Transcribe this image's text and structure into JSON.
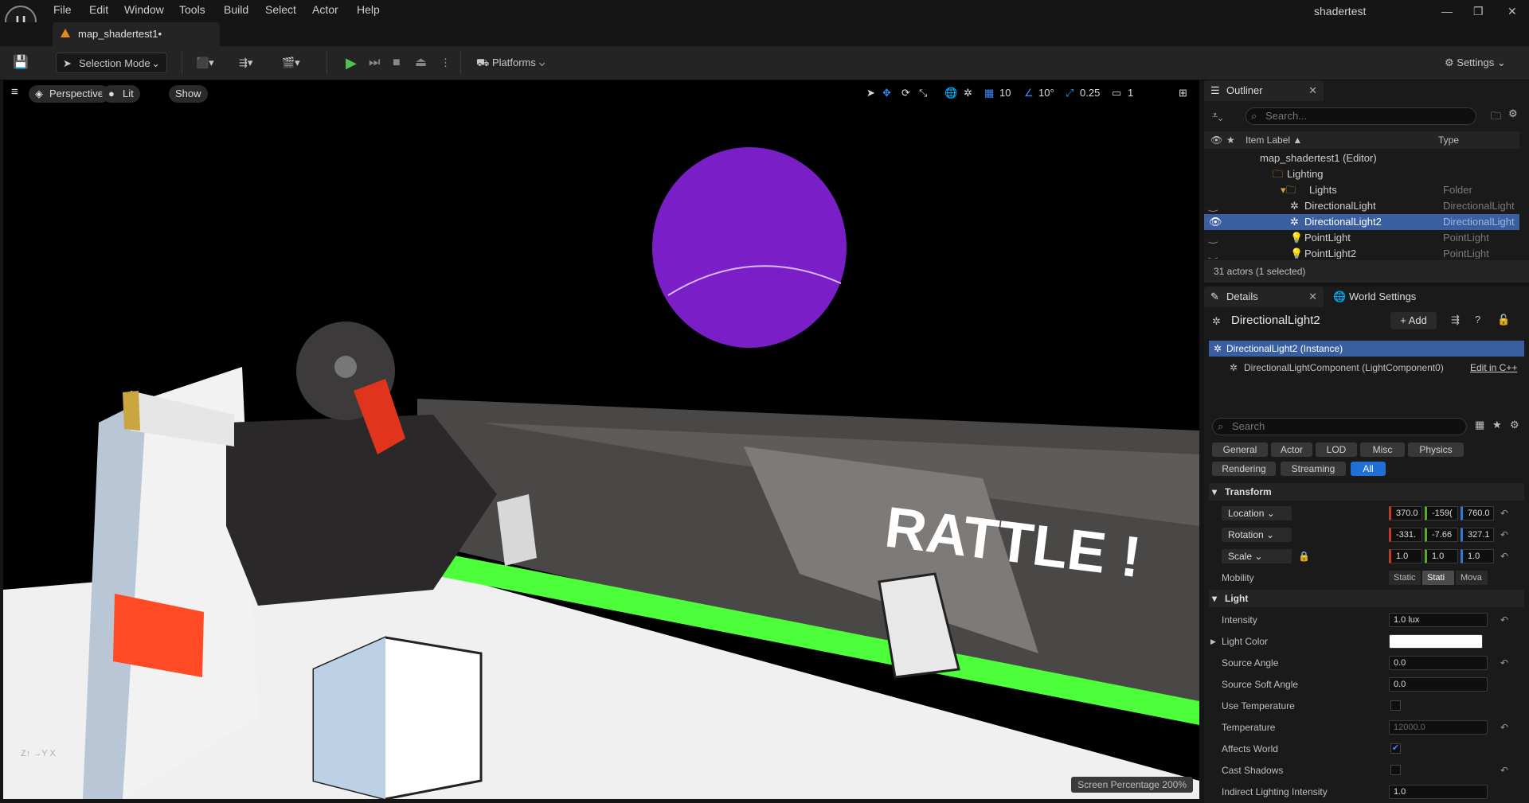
{
  "menu": [
    "File",
    "Edit",
    "Window",
    "Tools",
    "Build",
    "Select",
    "Actor",
    "Help"
  ],
  "project_name": "shadertest",
  "document_tab": "map_shadertest1•",
  "toolbar": {
    "selection_mode": "Selection Mode",
    "platforms": "Platforms",
    "settings": "Settings"
  },
  "viewport": {
    "perspective": "Perspective",
    "lit": "Lit",
    "show": "Show",
    "grid_snap": "10",
    "angle_snap": "10°",
    "scale_snap": "0.25",
    "camera_speed": "1",
    "screen_percentage": "Screen Percentage  200%",
    "scene_text": "RATTLE !"
  },
  "outliner": {
    "tab": "Outliner",
    "search_placeholder": "Search...",
    "col_label": "Item Label ▲",
    "col_type": "Type",
    "rows": [
      {
        "label": "map_shadertest1 (Editor)",
        "type": ""
      },
      {
        "label": "Lighting",
        "type": ""
      },
      {
        "label": "Lights",
        "type": "Folder"
      },
      {
        "label": "DirectionalLight",
        "type": "DirectionalLight"
      },
      {
        "label": "DirectionalLight2",
        "type": "DirectionalLight"
      },
      {
        "label": "PointLight",
        "type": "PointLight"
      },
      {
        "label": "PointLight2",
        "type": "PointLight"
      }
    ],
    "status": "31 actors (1 selected)"
  },
  "details": {
    "tab": "Details",
    "tab2": "World Settings",
    "actor_name": "DirectionalLight2",
    "add_label": "+ Add",
    "instance": "DirectionalLight2 (Instance)",
    "component": "DirectionalLightComponent (LightComponent0)",
    "edit_cpp": "Edit in C++",
    "search_placeholder": "Search",
    "categories": [
      "General",
      "Actor",
      "LOD",
      "Misc",
      "Physics",
      "Rendering",
      "Streaming",
      "All"
    ],
    "transform_head": "Transform",
    "location": {
      "label": "Location",
      "x": "370.0",
      "y": "-159(",
      "z": "760.0"
    },
    "rotation": {
      "label": "Rotation",
      "x": "-331.",
      "y": "-7.66",
      "z": "327.1"
    },
    "scale": {
      "label": "Scale",
      "x": "1.0",
      "y": "1.0",
      "z": "1.0"
    },
    "mobility": {
      "label": "Mobility",
      "opts": [
        "Static",
        "Stati",
        "Mova"
      ]
    },
    "light_head": "Light",
    "intensity": {
      "label": "Intensity",
      "value": "1.0 lux"
    },
    "light_color": {
      "label": "Light Color"
    },
    "source_angle": {
      "label": "Source Angle",
      "value": "0.0"
    },
    "source_soft_angle": {
      "label": "Source Soft Angle",
      "value": "0.0"
    },
    "use_temperature": {
      "label": "Use Temperature"
    },
    "temperature": {
      "label": "Temperature",
      "value": "12000.0"
    },
    "affects_world": {
      "label": "Affects World"
    },
    "cast_shadows": {
      "label": "Cast Shadows"
    },
    "indirect": {
      "label": "Indirect Lighting Intensity",
      "value": "1.0"
    }
  },
  "colors": {
    "accent": "#1f6fd6",
    "selection": "#3a5fa0",
    "sphere": "#7a1fc8",
    "green_stripe": "#4dff3a"
  }
}
